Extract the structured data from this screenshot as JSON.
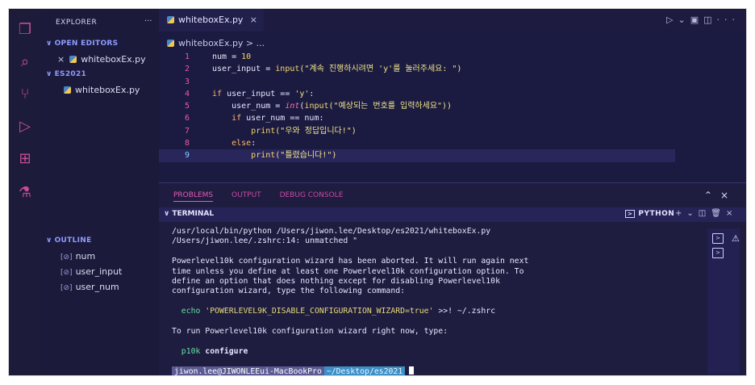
{
  "activity_bar": {
    "icons": [
      "files-icon",
      "search-icon",
      "source-control-icon",
      "run-debug-icon",
      "extensions-icon",
      "testing-icon"
    ]
  },
  "explorer": {
    "title": "EXPLORER",
    "more": "···",
    "open_editors_label": "OPEN EDITORS",
    "open_editor_file": "whiteboxEx.py",
    "folder_label": "ES2021",
    "folder_file": "whiteboxEx.py",
    "outline_label": "OUTLINE",
    "outline_items": [
      "num",
      "user_input",
      "user_num"
    ]
  },
  "editor": {
    "tab_label": "whiteboxEx.py",
    "breadcrumb": "whiteboxEx.py > ...",
    "lines": [
      {
        "n": "1"
      },
      {
        "n": "2"
      },
      {
        "n": "3"
      },
      {
        "n": "4"
      },
      {
        "n": "5"
      },
      {
        "n": "6"
      },
      {
        "n": "7"
      },
      {
        "n": "8"
      },
      {
        "n": "9"
      }
    ],
    "code": {
      "l1_var": "num",
      "l1_eq": " = ",
      "l1_val": "10",
      "l2_var": "user_input",
      "l2_eq": " = ",
      "l2_fn": "input",
      "l2_str": "(\"계속 진행하시려면 'y'를 눌러주세요: \")",
      "l4_kw": "if",
      "l4_rest": " user_input == ",
      "l4_str": "'y'",
      "l4_colon": ":",
      "l5_var": "user_num",
      "l5_eq": " = ",
      "l5_int": "int",
      "l5_open": "(",
      "l5_fn": "input",
      "l5_str": "(\"예상되는 번호를 입력하세요\"))",
      "l6_kw": "if",
      "l6_rest": " user_num == num:",
      "l7_fn": "print",
      "l7_str": "(\"우와 정답입니다!\")",
      "l8_kw": "else",
      "l8_colon": ":",
      "l9_fn": "print",
      "l9_str": "(\"틀렸습니다!\")"
    }
  },
  "panel": {
    "tabs": [
      "PROBLEMS",
      "OUTPUT",
      "DEBUG CONSOLE"
    ],
    "terminal_title": "TERMINAL",
    "terminal_profile": "PYTHON",
    "terminal_lines": [
      "/usr/local/bin/python /Users/jiwon.lee/Desktop/es2021/whiteboxEx.py",
      "/Users/jiwon.lee/.zshrc:14: unmatched \"",
      "Powerlevel10k configuration wizard has been aborted. It will run again next",
      "time unless you define at least one Powerlevel10k configuration option. To",
      "define an option that does nothing except for disabling Powerlevel10k",
      "configuration wizard, type the following command:"
    ],
    "echo_cmd": "echo",
    "echo_arg": "'POWERLEVEL9K_DISABLE_CONFIGURATION_WIZARD=true'",
    "echo_tail": " >>! ~/.zshrc",
    "run_line": "To run Powerlevel10k configuration wizard right now, type:",
    "p10k_cmd": "p10k",
    "p10k_arg": "configure",
    "prompt_user": "jiwon.lee@JIWONLEEui-MacBookPro",
    "prompt_path": "~/Desktop/es2021"
  },
  "colors": {
    "accent": "#c34e94",
    "background": "#1b1a3f",
    "line_number": "#ec5aa2"
  }
}
